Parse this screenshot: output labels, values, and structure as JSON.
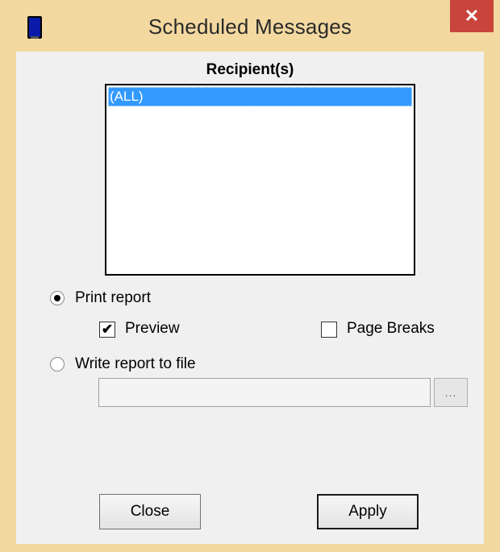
{
  "window": {
    "title": "Scheduled Messages",
    "close_glyph": "✕",
    "app_icon": "phone-device-icon",
    "frame_color": "#f3d9a0",
    "close_color": "#c9443a"
  },
  "recipients": {
    "label": "Recipient(s)",
    "items": [
      "(ALL)"
    ],
    "selected_index": 0,
    "selection_color": "#3399ff"
  },
  "output": {
    "print_report_label": "Print report",
    "print_report_selected": true,
    "preview_label": "Preview",
    "preview_checked": true,
    "page_breaks_label": "Page Breaks",
    "page_breaks_checked": false,
    "write_file_label": "Write report to file",
    "write_file_selected": false,
    "file_path_value": "",
    "browse_label": "..."
  },
  "buttons": {
    "close_label": "Close",
    "apply_label": "Apply"
  }
}
